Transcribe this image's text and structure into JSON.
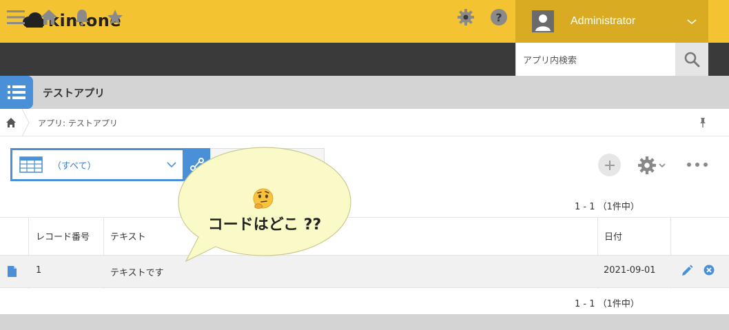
{
  "header": {
    "brand": "kintone",
    "user_name": "Administrator"
  },
  "search": {
    "placeholder": "アプリ内検索"
  },
  "app": {
    "title": "テストアプリ"
  },
  "breadcrumb": {
    "text": "アプリ: テストアプリ"
  },
  "view": {
    "selected": "（すべて）"
  },
  "pager": {
    "top": "1 - 1 （1件中）",
    "bottom": "1 - 1 （1件中）"
  },
  "table": {
    "columns": [
      "レコード番号",
      "テキスト",
      "日付"
    ],
    "rows": [
      {
        "record_no": "1",
        "text": "テキストです",
        "date": "2021-09-01"
      }
    ]
  },
  "bubble": {
    "text": "コードはどこ ??",
    "emoji": "thinking-face-icon"
  },
  "colors": {
    "header_yellow": "#f4c332",
    "user_box": "#d9ab22",
    "nav_dark": "#3a3a3a",
    "accent_blue": "#4a90d9",
    "bubble_fill": "#fafac8"
  }
}
